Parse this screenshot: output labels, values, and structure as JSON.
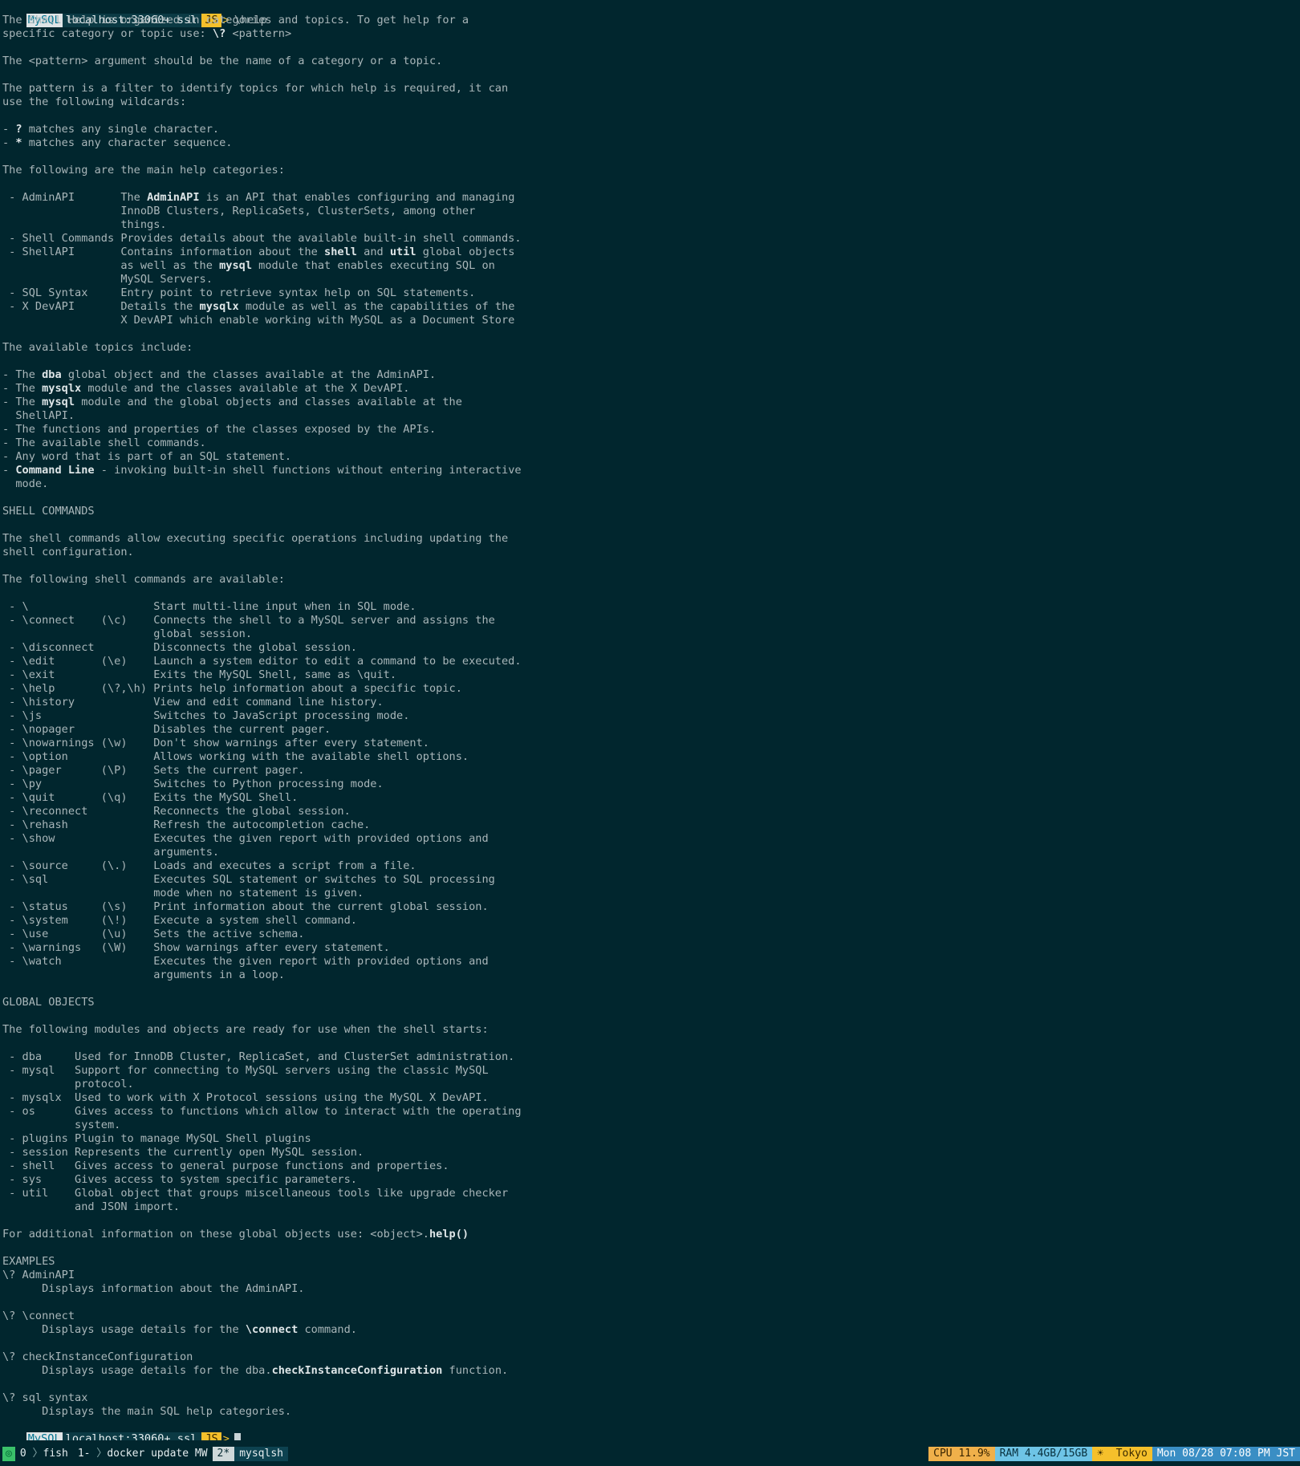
{
  "prompt": {
    "mysql": "MySQL",
    "host": "localhost:33060+ ssl",
    "mode": "JS",
    "arrow": ">",
    "command": "\\help"
  },
  "lines": [
    [
      {
        "t": "The Shell Help is organized in categories and topics. To get help for a"
      }
    ],
    [
      {
        "t": "specific category or topic use: "
      },
      {
        "t": "\\?",
        "b": true
      },
      {
        "t": " <pattern>"
      }
    ],
    [],
    [
      {
        "t": "The <pattern> argument should be the name of a category or a topic."
      }
    ],
    [],
    [
      {
        "t": "The pattern is a filter to identify topics for which help is required, it can"
      }
    ],
    [
      {
        "t": "use the following wildcards:"
      }
    ],
    [],
    [
      {
        "t": "- "
      },
      {
        "t": "?",
        "b": true
      },
      {
        "t": " matches any single character."
      }
    ],
    [
      {
        "t": "- "
      },
      {
        "t": "*",
        "b": true
      },
      {
        "t": " matches any character sequence."
      }
    ],
    [],
    [
      {
        "t": "The following are the main help categories:"
      }
    ],
    [],
    [
      {
        "t": " - AdminAPI       The "
      },
      {
        "t": "AdminAPI",
        "b": true
      },
      {
        "t": " is an API that enables configuring and managing"
      }
    ],
    [
      {
        "t": "                  InnoDB Clusters, ReplicaSets, ClusterSets, among other"
      }
    ],
    [
      {
        "t": "                  things."
      }
    ],
    [
      {
        "t": " - Shell Commands Provides details about the available built-in shell commands."
      }
    ],
    [
      {
        "t": " - ShellAPI       Contains information about the "
      },
      {
        "t": "shell",
        "b": true
      },
      {
        "t": " and "
      },
      {
        "t": "util",
        "b": true
      },
      {
        "t": " global objects"
      }
    ],
    [
      {
        "t": "                  as well as the "
      },
      {
        "t": "mysql",
        "b": true
      },
      {
        "t": " module that enables executing SQL on"
      }
    ],
    [
      {
        "t": "                  MySQL Servers."
      }
    ],
    [
      {
        "t": " - SQL Syntax     Entry point to retrieve syntax help on SQL statements."
      }
    ],
    [
      {
        "t": " - X DevAPI       Details the "
      },
      {
        "t": "mysqlx",
        "b": true
      },
      {
        "t": " module as well as the capabilities of the"
      }
    ],
    [
      {
        "t": "                  X DevAPI which enable working with MySQL as a Document Store"
      }
    ],
    [],
    [
      {
        "t": "The available topics include:"
      }
    ],
    [],
    [
      {
        "t": "- The "
      },
      {
        "t": "dba",
        "b": true
      },
      {
        "t": " global object and the classes available at the AdminAPI."
      }
    ],
    [
      {
        "t": "- The "
      },
      {
        "t": "mysqlx",
        "b": true
      },
      {
        "t": " module and the classes available at the X DevAPI."
      }
    ],
    [
      {
        "t": "- The "
      },
      {
        "t": "mysql",
        "b": true
      },
      {
        "t": " module and the global objects and classes available at the"
      }
    ],
    [
      {
        "t": "  ShellAPI."
      }
    ],
    [
      {
        "t": "- The functions and properties of the classes exposed by the APIs."
      }
    ],
    [
      {
        "t": "- The available shell commands."
      }
    ],
    [
      {
        "t": "- Any word that is part of an SQL statement."
      }
    ],
    [
      {
        "t": "- "
      },
      {
        "t": "Command Line",
        "b": true
      },
      {
        "t": " - invoking built-in shell functions without entering interactive"
      }
    ],
    [
      {
        "t": "  mode."
      }
    ],
    [],
    [
      {
        "t": "SHELL COMMANDS"
      }
    ],
    [],
    [
      {
        "t": "The shell commands allow executing specific operations including updating the"
      }
    ],
    [
      {
        "t": "shell configuration."
      }
    ],
    [],
    [
      {
        "t": "The following shell commands are available:"
      }
    ],
    [],
    [
      {
        "t": " - \\                   Start multi-line input when in SQL mode."
      }
    ],
    [
      {
        "t": " - \\connect    (\\c)    Connects the shell to a MySQL server and assigns the"
      }
    ],
    [
      {
        "t": "                       global session."
      }
    ],
    [
      {
        "t": " - \\disconnect         Disconnects the global session."
      }
    ],
    [
      {
        "t": " - \\edit       (\\e)    Launch a system editor to edit a command to be executed."
      }
    ],
    [
      {
        "t": " - \\exit               Exits the MySQL Shell, same as \\quit."
      }
    ],
    [
      {
        "t": " - \\help       (\\?,\\h) Prints help information about a specific topic."
      }
    ],
    [
      {
        "t": " - \\history            View and edit command line history."
      }
    ],
    [
      {
        "t": " - \\js                 Switches to JavaScript processing mode."
      }
    ],
    [
      {
        "t": " - \\nopager            Disables the current pager."
      }
    ],
    [
      {
        "t": " - \\nowarnings (\\w)    Don't show warnings after every statement."
      }
    ],
    [
      {
        "t": " - \\option             Allows working with the available shell options."
      }
    ],
    [
      {
        "t": " - \\pager      (\\P)    Sets the current pager."
      }
    ],
    [
      {
        "t": " - \\py                 Switches to Python processing mode."
      }
    ],
    [
      {
        "t": " - \\quit       (\\q)    Exits the MySQL Shell."
      }
    ],
    [
      {
        "t": " - \\reconnect          Reconnects the global session."
      }
    ],
    [
      {
        "t": " - \\rehash             Refresh the autocompletion cache."
      }
    ],
    [
      {
        "t": " - \\show               Executes the given report with provided options and"
      }
    ],
    [
      {
        "t": "                       arguments."
      }
    ],
    [
      {
        "t": " - \\source     (\\.)    Loads and executes a script from a file."
      }
    ],
    [
      {
        "t": " - \\sql                Executes SQL statement or switches to SQL processing"
      }
    ],
    [
      {
        "t": "                       mode when no statement is given."
      }
    ],
    [
      {
        "t": " - \\status     (\\s)    Print information about the current global session."
      }
    ],
    [
      {
        "t": " - \\system     (\\!)    Execute a system shell command."
      }
    ],
    [
      {
        "t": " - \\use        (\\u)    Sets the active schema."
      }
    ],
    [
      {
        "t": " - \\warnings   (\\W)    Show warnings after every statement."
      }
    ],
    [
      {
        "t": " - \\watch              Executes the given report with provided options and"
      }
    ],
    [
      {
        "t": "                       arguments in a loop."
      }
    ],
    [],
    [
      {
        "t": "GLOBAL OBJECTS"
      }
    ],
    [],
    [
      {
        "t": "The following modules and objects are ready for use when the shell starts:"
      }
    ],
    [],
    [
      {
        "t": " - dba     Used for InnoDB Cluster, ReplicaSet, and ClusterSet administration."
      }
    ],
    [
      {
        "t": " - mysql   Support for connecting to MySQL servers using the classic MySQL"
      }
    ],
    [
      {
        "t": "           protocol."
      }
    ],
    [
      {
        "t": " - mysqlx  Used to work with X Protocol sessions using the MySQL X DevAPI."
      }
    ],
    [
      {
        "t": " - os      Gives access to functions which allow to interact with the operating"
      }
    ],
    [
      {
        "t": "           system."
      }
    ],
    [
      {
        "t": " - plugins Plugin to manage MySQL Shell plugins"
      }
    ],
    [
      {
        "t": " - session Represents the currently open MySQL session."
      }
    ],
    [
      {
        "t": " - shell   Gives access to general purpose functions and properties."
      }
    ],
    [
      {
        "t": " - sys     Gives access to system specific parameters."
      }
    ],
    [
      {
        "t": " - util    Global object that groups miscellaneous tools like upgrade checker"
      }
    ],
    [
      {
        "t": "           and JSON import."
      }
    ],
    [],
    [
      {
        "t": "For additional information on these global objects use: <object>."
      },
      {
        "t": "help()",
        "b": true
      }
    ],
    [],
    [
      {
        "t": "EXAMPLES"
      }
    ],
    [
      {
        "t": "\\? AdminAPI"
      }
    ],
    [
      {
        "t": "      Displays information about the AdminAPI."
      }
    ],
    [],
    [
      {
        "t": "\\? \\connect"
      }
    ],
    [
      {
        "t": "      Displays usage details for the "
      },
      {
        "t": "\\connect",
        "b": true
      },
      {
        "t": " command."
      }
    ],
    [],
    [
      {
        "t": "\\? checkInstanceConfiguration"
      }
    ],
    [
      {
        "t": "      Displays usage details for the dba."
      },
      {
        "t": "checkInstanceConfiguration",
        "b": true
      },
      {
        "t": " function."
      }
    ],
    [],
    [
      {
        "t": "\\? sql syntax"
      }
    ],
    [
      {
        "t": "      Displays the main SQL help categories."
      }
    ]
  ],
  "statusbar": {
    "session_indicator": "◎",
    "windows": [
      {
        "index": "0",
        "name": "fish",
        "state": "normal"
      },
      {
        "index": "1-",
        "name": "docker update MW",
        "state": "last"
      },
      {
        "index": "2*",
        "name": "mysqlsh",
        "state": "current"
      }
    ],
    "separator": "〉",
    "cpu": "CPU 11.9%",
    "ram": "RAM 4.4GB/15GB",
    "weather_icon": "☀",
    "location": "Tokyo",
    "datetime": "Mon 08/28 07:08 PM JST",
    "colors": {
      "cpu": "#f0b04a",
      "ram": "#6ec4e6",
      "weather": "#f5c02b",
      "time": "#3a8ec4",
      "indicator": "#3ac16a"
    }
  }
}
